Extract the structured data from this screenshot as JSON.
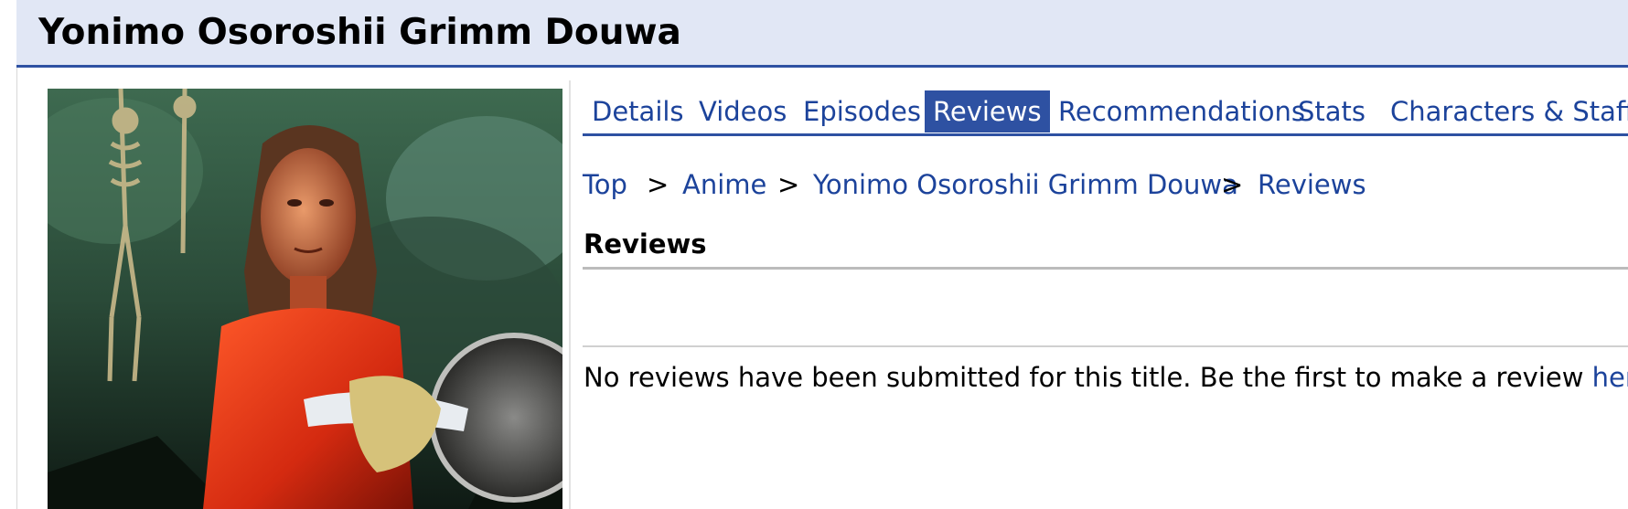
{
  "title": "Yonimo Osoroshii Grimm Douwa",
  "tabs": [
    {
      "label": "Details",
      "active": false
    },
    {
      "label": "Videos",
      "active": false
    },
    {
      "label": "Episodes",
      "active": false
    },
    {
      "label": "Reviews",
      "active": true
    },
    {
      "label": "Recommendations",
      "active": false
    },
    {
      "label": "Stats",
      "active": false
    },
    {
      "label": "Characters & Staff",
      "active": false
    }
  ],
  "breadcrumb": {
    "items": [
      "Top",
      "Anime",
      "Yonimo Osoroshii Grimm Douwa",
      "Reviews"
    ],
    "separator": ">"
  },
  "section_heading": "Reviews",
  "empty_message": {
    "text": "No reviews have been submitted for this title. Be the first to make a review ",
    "link": "here",
    "suffix": "!"
  },
  "colors": {
    "title_bar_bg": "#e1e7f5",
    "accent": "#2e51a2",
    "link": "#1c439b"
  }
}
